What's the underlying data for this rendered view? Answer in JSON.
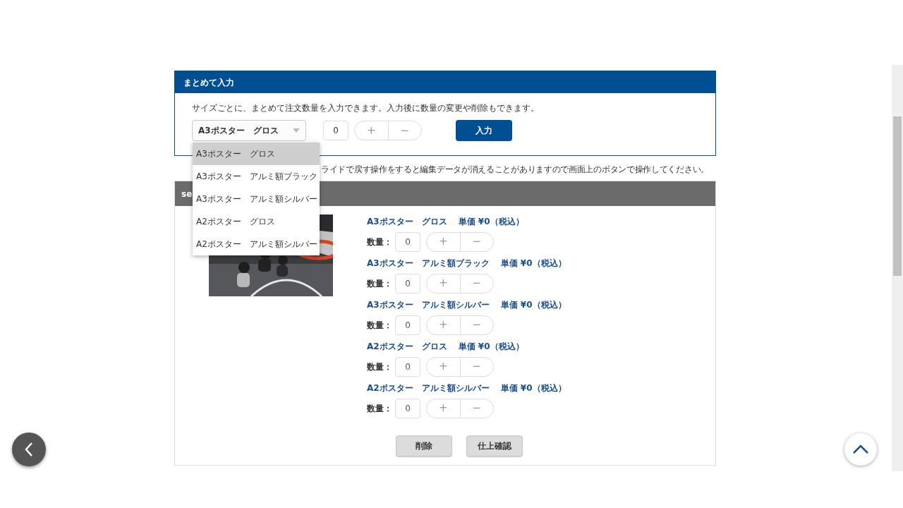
{
  "bulk_panel": {
    "title": "まとめて入力",
    "description": "サイズごとに、まとめて注文数量を入力できます。入力後に数量の変更や削除もできます。",
    "size_select": {
      "value": "A3ポスター　グロス",
      "expanded": true,
      "options": [
        {
          "label": "A3ポスター　グロス",
          "selected": true
        },
        {
          "label": "A3ポスター　アルミ額ブラック",
          "selected": false
        },
        {
          "label": "A3ポスター　アルミ額シルバー",
          "selected": false
        },
        {
          "label": "A2ポスター　グロス",
          "selected": false
        },
        {
          "label": "A2ポスター　アルミ額シルバー",
          "selected": false
        }
      ]
    },
    "quantity": "0",
    "plus": "+",
    "minus": "−",
    "submit": "入力"
  },
  "note": "ライドで戻す操作をすると編集データが消えることがありますので画面上のボタンで操作してください。",
  "section": {
    "title": "se",
    "items": [
      {
        "name": "A3ポスター　グロス",
        "price": "単価 ¥0（税込）",
        "quantity_label": "数量：",
        "quantity": "0",
        "plus": "+",
        "minus": "−"
      },
      {
        "name": "A3ポスター　アルミ額ブラック",
        "price": "単価 ¥0（税込）",
        "quantity_label": "数量：",
        "quantity": "0",
        "plus": "+",
        "minus": "−"
      },
      {
        "name": "A3ポスター　アルミ額シルバー",
        "price": "単価 ¥0（税込）",
        "quantity_label": "数量：",
        "quantity": "0",
        "plus": "+",
        "minus": "−"
      },
      {
        "name": "A2ポスター　グロス",
        "price": "単価 ¥0（税込）",
        "quantity_label": "数量：",
        "quantity": "0",
        "plus": "+",
        "minus": "−"
      },
      {
        "name": "A2ポスター　アルミ額シルバー",
        "price": "単価 ¥0（税込）",
        "quantity_label": "数量：",
        "quantity": "0",
        "plus": "+",
        "minus": "−"
      }
    ],
    "buttons": [
      "削除",
      "仕上確認"
    ]
  }
}
